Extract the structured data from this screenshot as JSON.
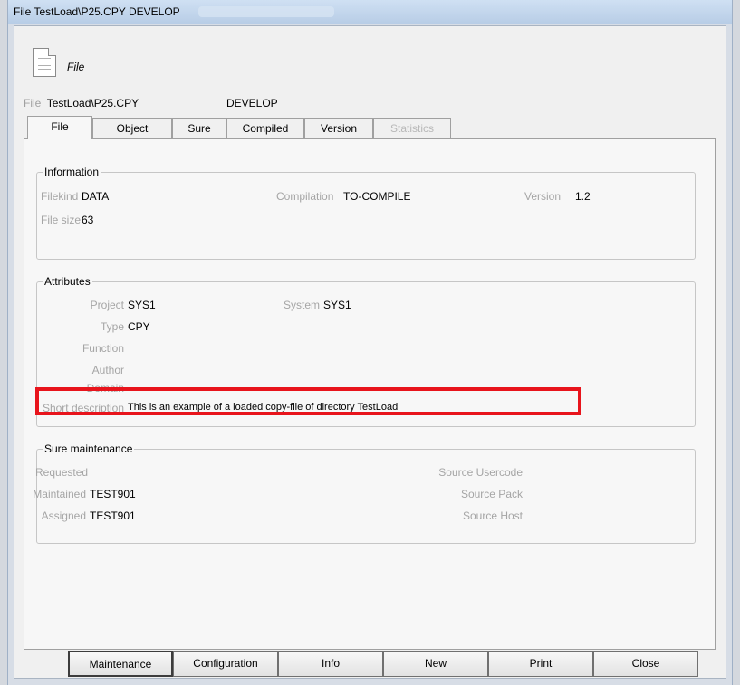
{
  "window": {
    "title": "File TestLoad\\P25.CPY DEVELOP"
  },
  "header": {
    "icon": "document-icon",
    "label": "File",
    "file_label": "File",
    "file_path": "TestLoad\\P25.CPY",
    "environment": "DEVELOP"
  },
  "tabs": [
    {
      "label": "File",
      "active": true,
      "enabled": true
    },
    {
      "label": "Object",
      "active": false,
      "enabled": true
    },
    {
      "label": "Sure",
      "active": false,
      "enabled": true
    },
    {
      "label": "Compiled",
      "active": false,
      "enabled": true
    },
    {
      "label": "Version",
      "active": false,
      "enabled": true
    },
    {
      "label": "Statistics",
      "active": false,
      "enabled": false
    }
  ],
  "information": {
    "title": "Information",
    "filekind_label": "Filekind",
    "filekind_value": "DATA",
    "compilation_label": "Compilation",
    "compilation_value": "TO-COMPILE",
    "version_label": "Version",
    "version_value": "1.2",
    "filesize_label": "File size",
    "filesize_value": "63"
  },
  "attributes": {
    "title": "Attributes",
    "project_label": "Project",
    "project_value": "SYS1",
    "system_label": "System",
    "system_value": "SYS1",
    "type_label": "Type",
    "type_value": "CPY",
    "function_label": "Function",
    "author_label": "Author",
    "domain_label": "Domain",
    "short_description_label": "Short description",
    "short_description_value": "This is an example of a loaded copy-file of directory TestLoad"
  },
  "sure_maintenance": {
    "title": "Sure maintenance",
    "requested_label": "Requested",
    "maintained_label": "Maintained",
    "maintained_value": "TEST901",
    "assigned_label": "Assigned",
    "assigned_value": "TEST901",
    "source_usercode_label": "Source Usercode",
    "source_pack_label": "Source Pack",
    "source_host_label": "Source Host"
  },
  "buttons": {
    "maintenance": "Maintenance",
    "configuration": "Configuration",
    "info": "Info",
    "new": "New",
    "print": "Print",
    "close": "Close"
  },
  "colors": {
    "highlight": "#e8141c",
    "disabled_text": "#a5a5a5"
  }
}
